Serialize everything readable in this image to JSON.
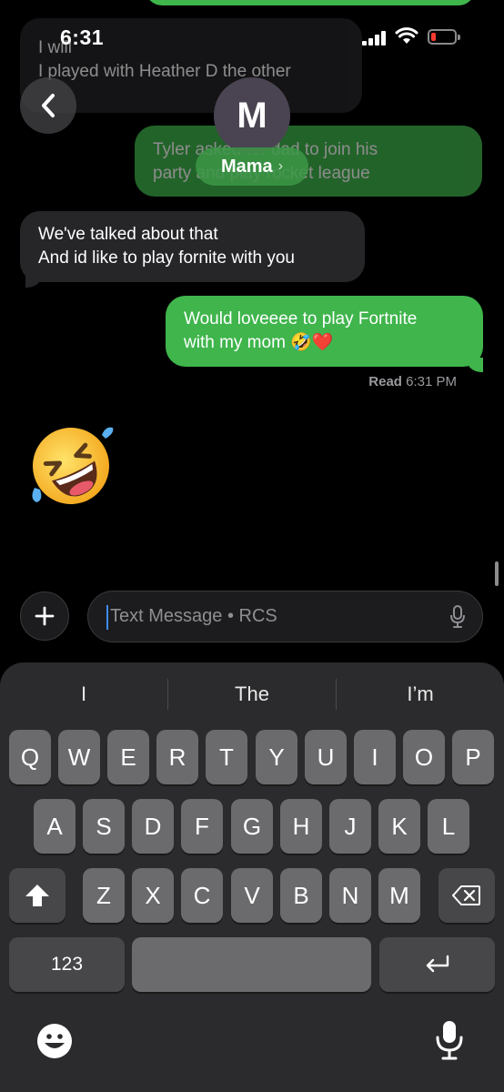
{
  "status_bar": {
    "time": "6:31"
  },
  "header": {
    "contact_name": "Mama",
    "avatar_initial": "M",
    "back_label": "Back"
  },
  "messages": [
    {
      "direction": "incoming",
      "lines": [
        "I will",
        "I played with Heather D the other"
      ]
    },
    {
      "direction": "outgoing",
      "lines": [
        "Tyler asked for dad to join his",
        "party and play rocket league"
      ]
    },
    {
      "direction": "incoming",
      "lines": [
        "We've talked about that",
        "And id like to play fornite with you"
      ]
    },
    {
      "direction": "outgoing",
      "lines": [
        "Would loveeee to play Fortnite",
        "with my mom 🤣❤️"
      ]
    },
    {
      "direction": "incoming",
      "emoji": "🤣"
    }
  ],
  "read_receipt": {
    "label": "Read",
    "time": "6:31 PM"
  },
  "compose": {
    "placeholder": "Text Message • RCS"
  },
  "keyboard": {
    "suggestions": [
      "I",
      "The",
      "I’m"
    ],
    "row1": [
      "Q",
      "W",
      "E",
      "R",
      "T",
      "Y",
      "U",
      "I",
      "O",
      "P"
    ],
    "row2": [
      "A",
      "S",
      "D",
      "F",
      "G",
      "H",
      "J",
      "K",
      "L"
    ],
    "row3": [
      "Z",
      "X",
      "C",
      "V",
      "B",
      "N",
      "M"
    ],
    "numbers_label": "123"
  },
  "colors": {
    "outgoing_bubble": "#3fb54c",
    "incoming_bubble": "#262629",
    "background": "#000000",
    "cursor": "#3d8bf7"
  }
}
